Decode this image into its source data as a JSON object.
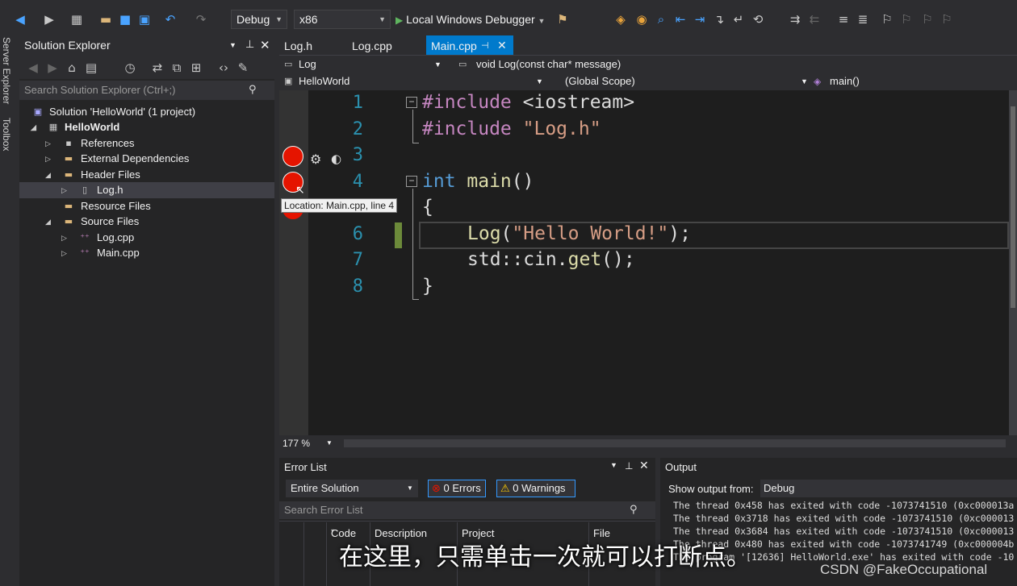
{
  "toolbar": {
    "config": "Debug",
    "platform": "x86",
    "run_label": "Local Windows Debugger"
  },
  "left_strip": [
    "Server Explorer",
    "Toolbox"
  ],
  "solution_explorer": {
    "title": "Solution Explorer",
    "search_placeholder": "Search Solution Explorer (Ctrl+;)",
    "items": [
      {
        "label": "Solution 'HelloWorld' (1 project)",
        "icon": "solution-icon"
      },
      {
        "label": "HelloWorld",
        "icon": "project-icon"
      },
      {
        "label": "References",
        "icon": "references-icon"
      },
      {
        "label": "External Dependencies",
        "icon": "dependencies-icon"
      },
      {
        "label": "Header Files",
        "icon": "folder-icon"
      },
      {
        "label": "Log.h",
        "icon": "header-file-icon"
      },
      {
        "label": "Resource Files",
        "icon": "folder-icon"
      },
      {
        "label": "Source Files",
        "icon": "folder-icon"
      },
      {
        "label": "Log.cpp",
        "icon": "cpp-file-icon"
      },
      {
        "label": "Main.cpp",
        "icon": "cpp-file-icon"
      }
    ]
  },
  "editor": {
    "tabs": [
      "Log.h",
      "Log.cpp",
      "Main.cpp"
    ],
    "active_tab": "Main.cpp",
    "nav": {
      "scope1": "Log",
      "member": "void Log(const char* message)",
      "project": "HelloWorld",
      "scope2": "(Global Scope)",
      "function": "main()"
    },
    "line_numbers": [
      "1",
      "2",
      "3",
      "4",
      "5",
      "6",
      "7",
      "8"
    ],
    "code": {
      "l1_dir": "#include",
      "l1_rest": " <iostream>",
      "l2_dir": "#include",
      "l2_str": " \"Log.h\"",
      "l4_kw": "int",
      "l4_fn": " main",
      "l4_rest": "()",
      "l5": "{",
      "l6_fn": "Log",
      "l6_p1": "(",
      "l6_str": "\"Hello World!\"",
      "l6_p2": ");",
      "l7_a": "std::cin.",
      "l7_fn": "get",
      "l7_b": "();",
      "l8": "}"
    },
    "tooltip": "Location: Main.cpp, line 4",
    "zoom": "177 %"
  },
  "error_list": {
    "title": "Error List",
    "scope": "Entire Solution",
    "errors": "0 Errors",
    "warnings": "0 Warnings",
    "search_placeholder": "Search Error List",
    "columns": [
      "Code",
      "Description",
      "Project",
      "File"
    ]
  },
  "output": {
    "title": "Output",
    "show_from_label": "Show output from:",
    "source": "Debug",
    "lines": [
      "The thread 0x458 has exited with code -1073741510 (0xc000013a",
      "The thread 0x3718 has exited with code -1073741510 (0xc000013",
      "The thread 0x3684 has exited with code -1073741510 (0xc000013",
      "The thread 0x480 has exited with code -1073741749 (0xc000004b",
      "The program '[12636] HelloWorld.exe' has exited with code -10"
    ]
  },
  "overlay": {
    "subtitle": "在这里，只需单击一次就可以打断点。",
    "watermark": "CSDN @FakeOccupational"
  },
  "colors": {
    "accent": "#007acc",
    "breakpoint": "#e51400",
    "keyword": "#569cd6",
    "string": "#d69d85",
    "line_number": "#2b91af"
  }
}
